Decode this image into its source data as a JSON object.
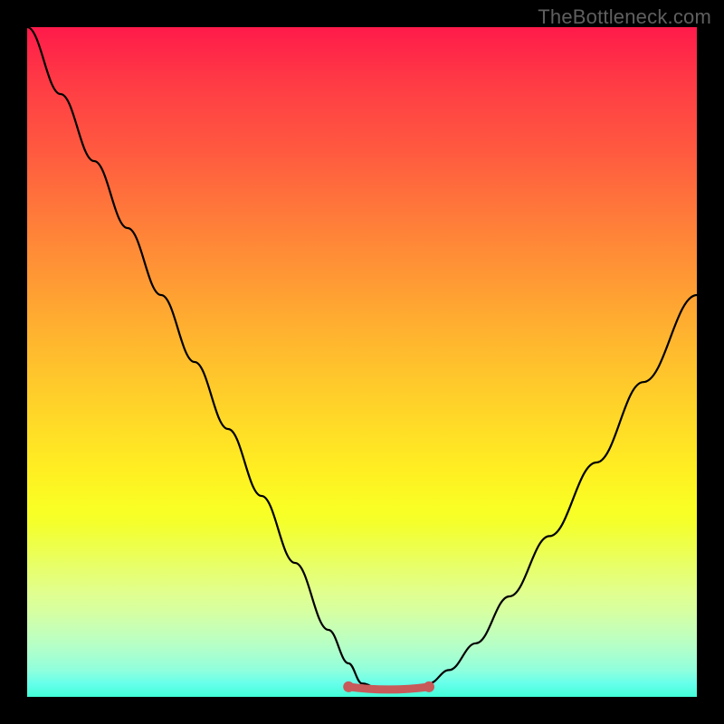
{
  "watermark": "TheBottleneck.com",
  "chart_data": {
    "type": "line",
    "title": "",
    "xlabel": "",
    "ylabel": "",
    "xlim": [
      0,
      100
    ],
    "ylim": [
      0,
      100
    ],
    "grid": false,
    "legend": false,
    "series": [
      {
        "name": "curve",
        "x": [
          0,
          5,
          10,
          15,
          20,
          25,
          30,
          35,
          40,
          45,
          48,
          50,
          53,
          56,
          58,
          60,
          63,
          67,
          72,
          78,
          85,
          92,
          100
        ],
        "values": [
          100,
          90,
          80,
          70,
          60,
          50,
          40,
          30,
          20,
          10,
          5,
          2,
          1,
          1,
          1,
          2,
          4,
          8,
          15,
          24,
          35,
          47,
          60
        ]
      }
    ],
    "trough_marker": {
      "x_start": 48,
      "x_end": 60,
      "y": 1.5,
      "color": "#c85a5a"
    },
    "background_gradient": {
      "top": "#ff1a4a",
      "mid": "#ffd728",
      "bottom": "#00ffc0"
    }
  }
}
